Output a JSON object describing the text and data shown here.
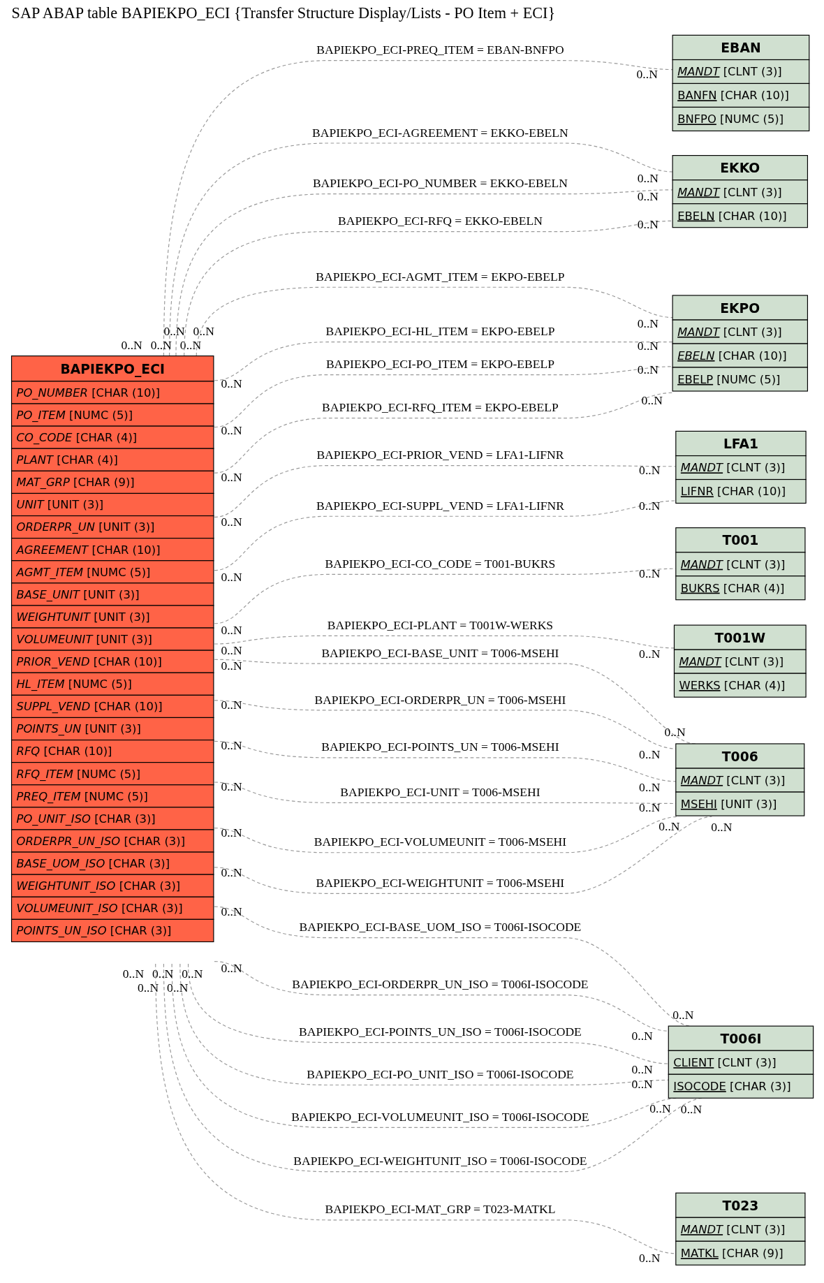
{
  "title": "SAP ABAP table BAPIEKPO_ECI {Transfer Structure Display/Lists - PO Item + ECI}",
  "tables": [
    {
      "name": "BAPIEKPO_ECI",
      "color": "#ff6347",
      "fields": [
        {
          "name": "PO_NUMBER",
          "type": "[CHAR (10)]",
          "italic": true,
          "underlined": false
        },
        {
          "name": "PO_ITEM",
          "type": "[NUMC (5)]",
          "italic": true,
          "underlined": false
        },
        {
          "name": "CO_CODE",
          "type": "[CHAR (4)]",
          "italic": true,
          "underlined": false
        },
        {
          "name": "PLANT",
          "type": "[CHAR (4)]",
          "italic": true,
          "underlined": false
        },
        {
          "name": "MAT_GRP",
          "type": "[CHAR (9)]",
          "italic": true,
          "underlined": false
        },
        {
          "name": "UNIT",
          "type": "[UNIT (3)]",
          "italic": true,
          "underlined": false
        },
        {
          "name": "ORDERPR_UN",
          "type": "[UNIT (3)]",
          "italic": true,
          "underlined": false
        },
        {
          "name": "AGREEMENT",
          "type": "[CHAR (10)]",
          "italic": true,
          "underlined": false
        },
        {
          "name": "AGMT_ITEM",
          "type": "[NUMC (5)]",
          "italic": true,
          "underlined": false
        },
        {
          "name": "BASE_UNIT",
          "type": "[UNIT (3)]",
          "italic": true,
          "underlined": false
        },
        {
          "name": "WEIGHTUNIT",
          "type": "[UNIT (3)]",
          "italic": true,
          "underlined": false
        },
        {
          "name": "VOLUMEUNIT",
          "type": "[UNIT (3)]",
          "italic": true,
          "underlined": false
        },
        {
          "name": "PRIOR_VEND",
          "type": "[CHAR (10)]",
          "italic": true,
          "underlined": false
        },
        {
          "name": "HL_ITEM",
          "type": "[NUMC (5)]",
          "italic": true,
          "underlined": false
        },
        {
          "name": "SUPPL_VEND",
          "type": "[CHAR (10)]",
          "italic": true,
          "underlined": false
        },
        {
          "name": "POINTS_UN",
          "type": "[UNIT (3)]",
          "italic": true,
          "underlined": false
        },
        {
          "name": "RFQ",
          "type": "[CHAR (10)]",
          "italic": true,
          "underlined": false
        },
        {
          "name": "RFQ_ITEM",
          "type": "[NUMC (5)]",
          "italic": true,
          "underlined": false
        },
        {
          "name": "PREQ_ITEM",
          "type": "[NUMC (5)]",
          "italic": true,
          "underlined": false
        },
        {
          "name": "PO_UNIT_ISO",
          "type": "[CHAR (3)]",
          "italic": true,
          "underlined": false
        },
        {
          "name": "ORDERPR_UN_ISO",
          "type": "[CHAR (3)]",
          "italic": true,
          "underlined": false
        },
        {
          "name": "BASE_UOM_ISO",
          "type": "[CHAR (3)]",
          "italic": true,
          "underlined": false
        },
        {
          "name": "WEIGHTUNIT_ISO",
          "type": "[CHAR (3)]",
          "italic": true,
          "underlined": false
        },
        {
          "name": "VOLUMEUNIT_ISO",
          "type": "[CHAR (3)]",
          "italic": true,
          "underlined": false
        },
        {
          "name": "POINTS_UN_ISO",
          "type": "[CHAR (3)]",
          "italic": true,
          "underlined": false
        }
      ]
    },
    {
      "name": "EBAN",
      "color": "#d0e0d0",
      "fields": [
        {
          "name": "MANDT",
          "type": "[CLNT (3)]",
          "italic": true,
          "underlined": true
        },
        {
          "name": "BANFN",
          "type": "[CHAR (10)]",
          "italic": false,
          "underlined": true
        },
        {
          "name": "BNFPO",
          "type": "[NUMC (5)]",
          "italic": false,
          "underlined": true
        }
      ]
    },
    {
      "name": "EKKO",
      "color": "#d0e0d0",
      "fields": [
        {
          "name": "MANDT",
          "type": "[CLNT (3)]",
          "italic": true,
          "underlined": true
        },
        {
          "name": "EBELN",
          "type": "[CHAR (10)]",
          "italic": false,
          "underlined": true
        }
      ]
    },
    {
      "name": "EKPO",
      "color": "#d0e0d0",
      "fields": [
        {
          "name": "MANDT",
          "type": "[CLNT (3)]",
          "italic": true,
          "underlined": true
        },
        {
          "name": "EBELN",
          "type": "[CHAR (10)]",
          "italic": true,
          "underlined": true
        },
        {
          "name": "EBELP",
          "type": "[NUMC (5)]",
          "italic": false,
          "underlined": true
        }
      ]
    },
    {
      "name": "LFA1",
      "color": "#d0e0d0",
      "fields": [
        {
          "name": "MANDT",
          "type": "[CLNT (3)]",
          "italic": true,
          "underlined": true
        },
        {
          "name": "LIFNR",
          "type": "[CHAR (10)]",
          "italic": false,
          "underlined": true
        }
      ]
    },
    {
      "name": "T001",
      "color": "#d0e0d0",
      "fields": [
        {
          "name": "MANDT",
          "type": "[CLNT (3)]",
          "italic": true,
          "underlined": true
        },
        {
          "name": "BUKRS",
          "type": "[CHAR (4)]",
          "italic": false,
          "underlined": true
        }
      ]
    },
    {
      "name": "T001W",
      "color": "#d0e0d0",
      "fields": [
        {
          "name": "MANDT",
          "type": "[CLNT (3)]",
          "italic": true,
          "underlined": true
        },
        {
          "name": "WERKS",
          "type": "[CHAR (4)]",
          "italic": false,
          "underlined": true
        }
      ]
    },
    {
      "name": "T006",
      "color": "#d0e0d0",
      "fields": [
        {
          "name": "MANDT",
          "type": "[CLNT (3)]",
          "italic": true,
          "underlined": true
        },
        {
          "name": "MSEHI",
          "type": "[UNIT (3)]",
          "italic": false,
          "underlined": true
        }
      ]
    },
    {
      "name": "T006I",
      "color": "#d0e0d0",
      "fields": [
        {
          "name": "CLIENT",
          "type": "[CLNT (3)]",
          "italic": false,
          "underlined": true
        },
        {
          "name": "ISOCODE",
          "type": "[CHAR (3)]",
          "italic": false,
          "underlined": true
        }
      ]
    },
    {
      "name": "T023",
      "color": "#d0e0d0",
      "fields": [
        {
          "name": "MANDT",
          "type": "[CLNT (3)]",
          "italic": true,
          "underlined": true
        },
        {
          "name": "MATKL",
          "type": "[CHAR (9)]",
          "italic": false,
          "underlined": true
        }
      ]
    }
  ],
  "relations": [
    {
      "label": "BAPIEKPO_ECI-PREQ_ITEM = EBAN-BNFPO",
      "source_card": "0..N",
      "target_card": "0..N"
    },
    {
      "label": "BAPIEKPO_ECI-AGREEMENT = EKKO-EBELN",
      "source_card": "0..N",
      "target_card": "0..N"
    },
    {
      "label": "BAPIEKPO_ECI-PO_NUMBER = EKKO-EBELN",
      "source_card": "0..N",
      "target_card": "0..N"
    },
    {
      "label": "BAPIEKPO_ECI-RFQ = EKKO-EBELN",
      "source_card": "0..N",
      "target_card": "0..N"
    },
    {
      "label": "BAPIEKPO_ECI-AGMT_ITEM = EKPO-EBELP",
      "source_card": "0..N",
      "target_card": "0..N"
    },
    {
      "label": "BAPIEKPO_ECI-HL_ITEM = EKPO-EBELP",
      "source_card": "0..N",
      "target_card": "0..N"
    },
    {
      "label": "BAPIEKPO_ECI-PO_ITEM = EKPO-EBELP",
      "source_card": "0..N",
      "target_card": "0..N"
    },
    {
      "label": "BAPIEKPO_ECI-RFQ_ITEM = EKPO-EBELP",
      "source_card": "0..N",
      "target_card": "0..N"
    },
    {
      "label": "BAPIEKPO_ECI-PRIOR_VEND = LFA1-LIFNR",
      "source_card": "0..N",
      "target_card": "0..N"
    },
    {
      "label": "BAPIEKPO_ECI-SUPPL_VEND = LFA1-LIFNR",
      "source_card": "0..N",
      "target_card": "0..N"
    },
    {
      "label": "BAPIEKPO_ECI-CO_CODE = T001-BUKRS",
      "source_card": "0..N",
      "target_card": "0..N"
    },
    {
      "label": "BAPIEKPO_ECI-PLANT = T001W-WERKS",
      "source_card": "0..N",
      "target_card": "0..N"
    },
    {
      "label": "BAPIEKPO_ECI-BASE_UNIT = T006-MSEHI",
      "source_card": "0..N",
      "target_card": "0..N"
    },
    {
      "label": "BAPIEKPO_ECI-ORDERPR_UN = T006-MSEHI",
      "source_card": "0..N",
      "target_card": "0..N"
    },
    {
      "label": "BAPIEKPO_ECI-POINTS_UN = T006-MSEHI",
      "source_card": "0..N",
      "target_card": "0..N"
    },
    {
      "label": "BAPIEKPO_ECI-UNIT = T006-MSEHI",
      "source_card": "0..N",
      "target_card": "0..N"
    },
    {
      "label": "BAPIEKPO_ECI-VOLUMEUNIT = T006-MSEHI",
      "source_card": "0..N",
      "target_card": "0..N"
    },
    {
      "label": "BAPIEKPO_ECI-WEIGHTUNIT = T006-MSEHI",
      "source_card": "0..N",
      "target_card": "0..N"
    },
    {
      "label": "BAPIEKPO_ECI-BASE_UOM_ISO = T006I-ISOCODE",
      "source_card": "0..N",
      "target_card": "0..N"
    },
    {
      "label": "BAPIEKPO_ECI-ORDERPR_UN_ISO = T006I-ISOCODE",
      "source_card": "0..N",
      "target_card": "0..N"
    },
    {
      "label": "BAPIEKPO_ECI-POINTS_UN_ISO = T006I-ISOCODE",
      "source_card": "0..N",
      "target_card": "0..N"
    },
    {
      "label": "BAPIEKPO_ECI-PO_UNIT_ISO = T006I-ISOCODE",
      "source_card": "0..N",
      "target_card": "0..N"
    },
    {
      "label": "BAPIEKPO_ECI-VOLUMEUNIT_ISO = T006I-ISOCODE",
      "source_card": "0..N",
      "target_card": "0..N"
    },
    {
      "label": "BAPIEKPO_ECI-WEIGHTUNIT_ISO = T006I-ISOCODE",
      "source_card": "0..N",
      "target_card": "0..N"
    },
    {
      "label": "BAPIEKPO_ECI-MAT_GRP = T023-MATKL",
      "source_card": "0..N",
      "target_card": "0..N"
    }
  ]
}
